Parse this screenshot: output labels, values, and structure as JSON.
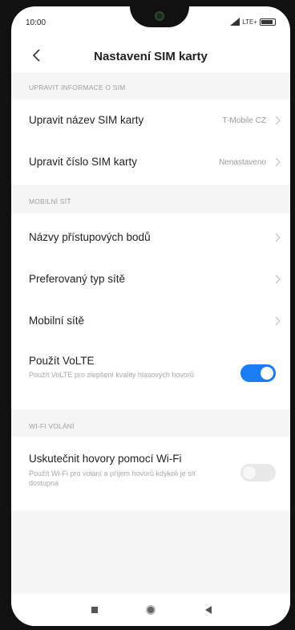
{
  "status_bar": {
    "time": "10:00",
    "network": "LTE+"
  },
  "header": {
    "title": "Nastavení SIM karty"
  },
  "sections": {
    "edit_sim": {
      "label": "UPRAVIT INFORMACE O SIM",
      "rows": [
        {
          "label": "Upravit název SIM karty",
          "value": "T-Mobile CZ"
        },
        {
          "label": "Upravit číslo SIM karty",
          "value": "Nenastaveno"
        }
      ]
    },
    "mobile_network": {
      "label": "MOBILNÍ SÍŤ",
      "rows": [
        {
          "label": "Názvy přístupových bodů"
        },
        {
          "label": "Preferovaný typ sítě"
        },
        {
          "label": "Mobilní sítě"
        }
      ],
      "volte": {
        "label": "Použít VoLTE",
        "description": "Použít VoLTE pro zlepšení kvality hlasových hovorů",
        "enabled": true
      }
    },
    "wifi_calling": {
      "label": "WI-FI VOLÁNÍ",
      "wifi_call": {
        "label": "Uskutečnit hovory pomocí Wi-Fi",
        "description": "Použít Wi-Fi pro volání a příjem hovorů kdykoli je síť dostupná",
        "enabled": false
      }
    }
  },
  "colors": {
    "accent": "#1a7df1",
    "section_bg": "#f5f5f5"
  },
  "nav_icons": [
    "recents-square-icon",
    "home-circle-icon",
    "back-triangle-icon"
  ]
}
